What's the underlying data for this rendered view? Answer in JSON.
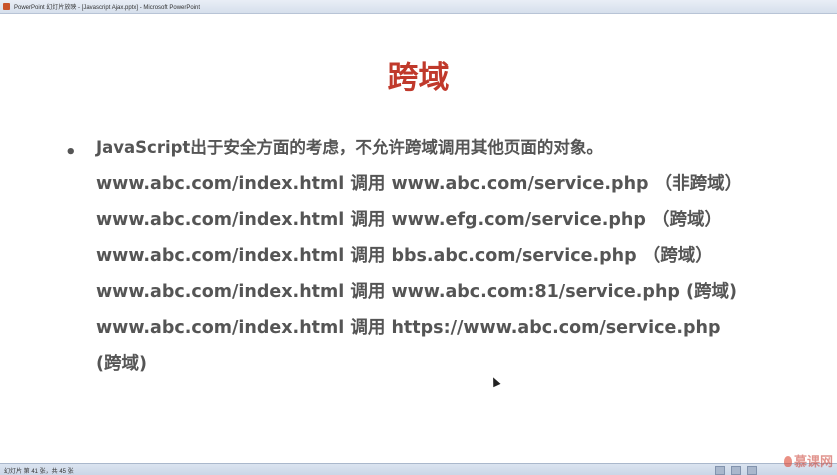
{
  "window": {
    "title": "PowerPoint 幻灯片放映 - [Javascript Ajax.pptx] - Microsoft PowerPoint"
  },
  "slide": {
    "title": "跨域",
    "bullet": "•",
    "lines": [
      "JavaScript出于安全方面的考虑，不允许跨域调用其他页面的对象。",
      "www.abc.com/index.html 调用 www.abc.com/service.php （非跨域）",
      "www.abc.com/index.html 调用 www.efg.com/service.php （跨域）",
      "www.abc.com/index.html 调用 bbs.abc.com/service.php （跨域）",
      "www.abc.com/index.html 调用 www.abc.com:81/service.php (跨域)",
      "www.abc.com/index.html 调用 https://www.abc.com/service.php",
      "(跨域)"
    ]
  },
  "statusbar": {
    "text": "幻灯片 第 41 张，共 45 张"
  },
  "watermark": {
    "text": "慕课网"
  }
}
